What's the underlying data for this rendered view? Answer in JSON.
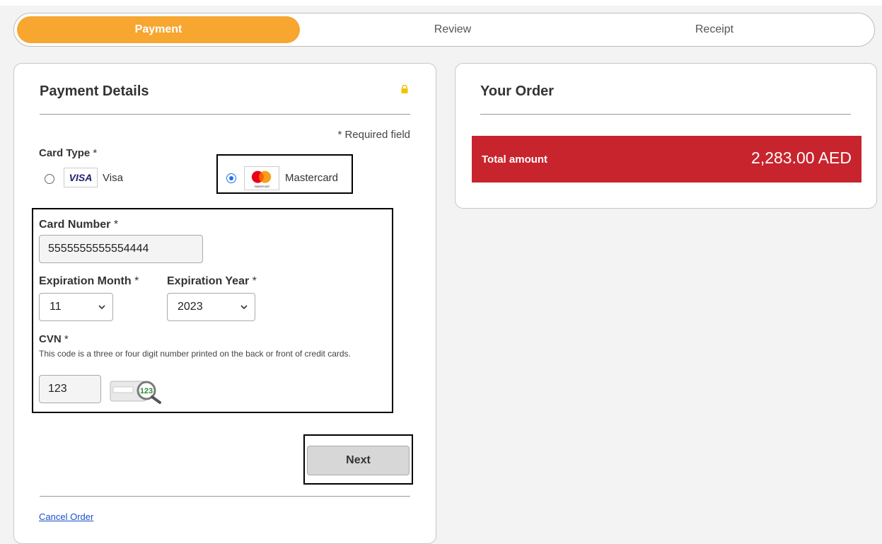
{
  "steps": {
    "payment": "Payment",
    "review": "Review",
    "receipt": "Receipt"
  },
  "payment": {
    "title": "Payment Details",
    "required_note": "* Required field",
    "card_type_label": "Card Type",
    "card_options": [
      {
        "label": "Visa",
        "logo": "VISA",
        "selected": false
      },
      {
        "label": "Mastercard",
        "logo": "mastercard",
        "selected": true
      }
    ],
    "card_number_label": "Card Number",
    "card_number_value": "5555555555554444",
    "exp_month_label": "Expiration Month",
    "exp_month_value": "11",
    "exp_year_label": "Expiration Year",
    "exp_year_value": "2023",
    "cvn_label": "CVN",
    "cvn_help": "This code is a three or four digit number printed on the back or front of credit cards.",
    "cvn_value": "123",
    "cvn_image_text": "123",
    "next_label": "Next",
    "cancel_label": "Cancel Order",
    "required_star": "*"
  },
  "order": {
    "title": "Your Order",
    "total_label": "Total amount",
    "total_amount": "2,283.00 AED"
  },
  "colors": {
    "accent": "#f7a630",
    "total_bar": "#c8242d",
    "radio": "#1a73e8",
    "link": "#1a4fcb"
  },
  "icons": {
    "lock": "lock-icon",
    "chevron": "chevron-down-icon"
  }
}
